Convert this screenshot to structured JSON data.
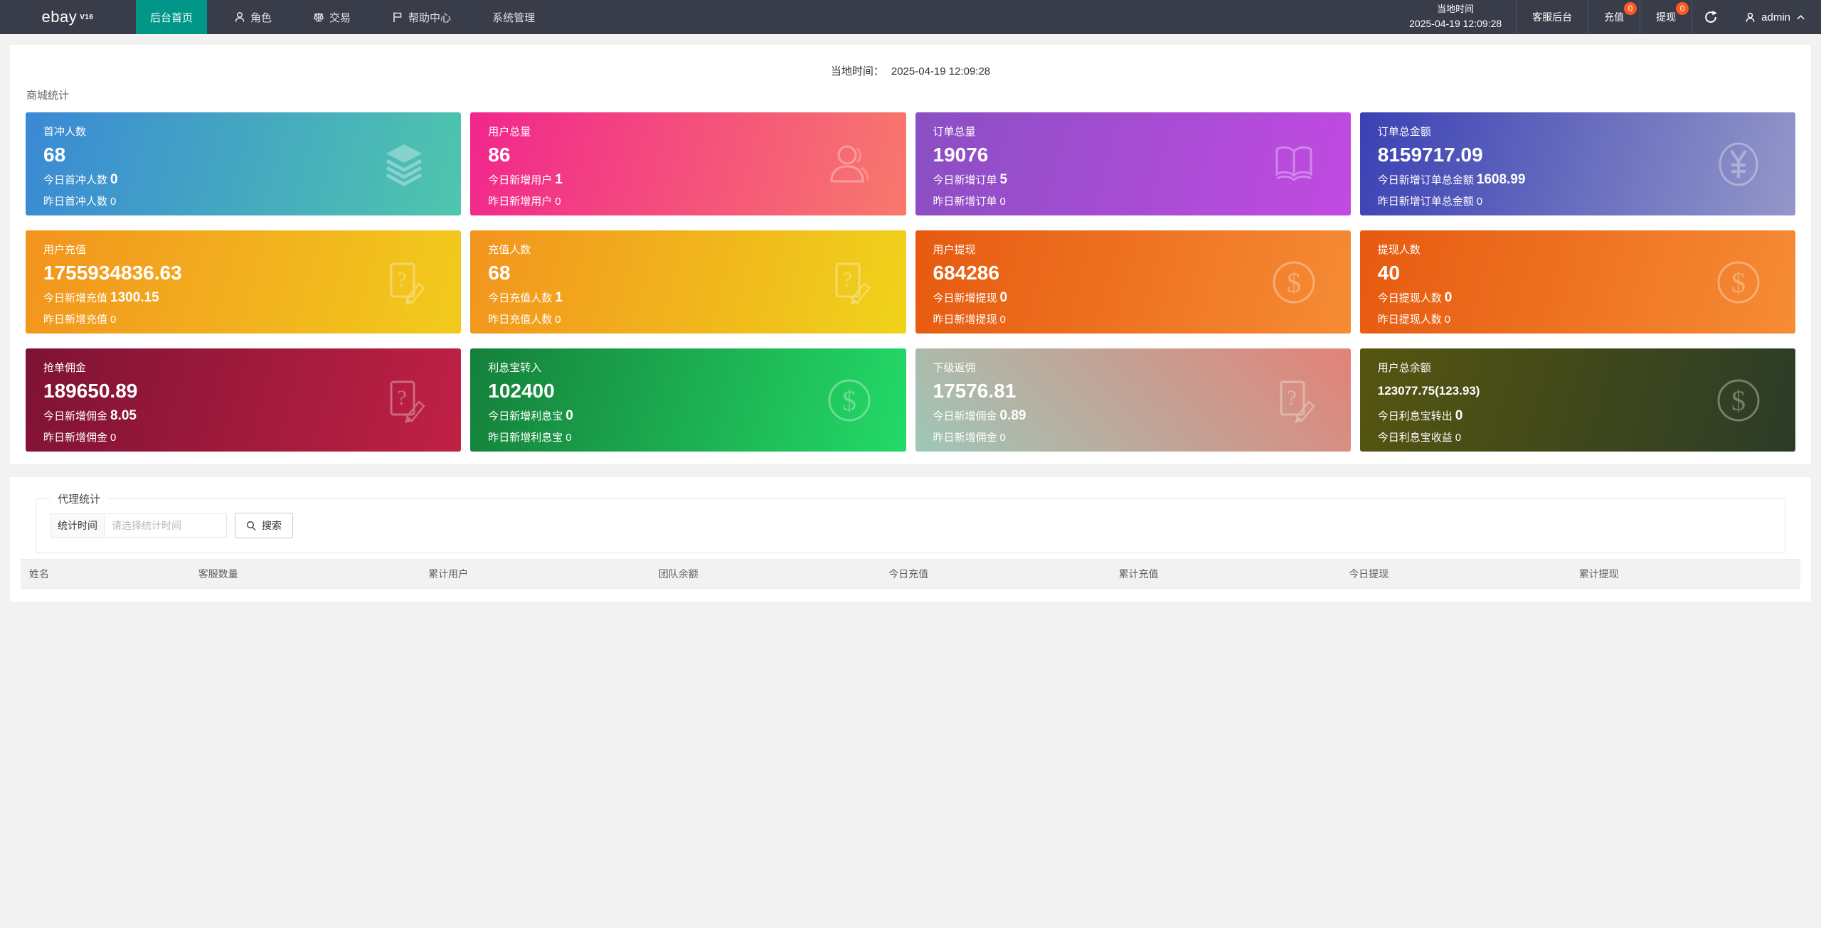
{
  "navbar": {
    "logo": "ebay",
    "logo_sup": "V16",
    "items": [
      {
        "label": "后台首页",
        "icon": null,
        "active": true
      },
      {
        "label": "角色",
        "icon": "user",
        "active": false
      },
      {
        "label": "交易",
        "icon": "scales",
        "active": false
      },
      {
        "label": "帮助中心",
        "icon": "flag",
        "active": false
      },
      {
        "label": "系统管理",
        "icon": null,
        "active": false
      }
    ],
    "time_block": {
      "label": "当地时间",
      "value": "2025-04-19 12:09:28"
    },
    "right_items": [
      {
        "label": "客服后台",
        "badge": null
      },
      {
        "label": "充值",
        "badge": "0"
      },
      {
        "label": "提现",
        "badge": "0"
      }
    ],
    "user": {
      "name": "admin"
    },
    "badge_color": "#ff5722",
    "active_color": "#009688",
    "bar_color": "#393d49"
  },
  "main": {
    "time_label": "当地时间：",
    "time_value": "2025-04-19 12:09:28",
    "section_title": "商城统计",
    "cards": [
      {
        "title": "首冲人数",
        "value": "68",
        "small": false,
        "line2_label": "今日首冲人数",
        "line2_value": "0",
        "line3_label": "昨日首冲人数",
        "line3_value": "0",
        "icon": "layers",
        "gradient": {
          "angle": 105,
          "from": "#3a89d5",
          "to": "#4fc6ad"
        }
      },
      {
        "title": "用户总量",
        "value": "86",
        "small": false,
        "line2_label": "今日新增用户",
        "line2_value": "1",
        "line3_label": "昨日新增用户",
        "line3_value": "0",
        "icon": "person",
        "gradient": {
          "angle": 105,
          "from": "#f1268d",
          "to": "#f8796c"
        }
      },
      {
        "title": "订单总量",
        "value": "19076",
        "small": false,
        "line2_label": "今日新增订单",
        "line2_value": "5",
        "line3_label": "昨日新增订单",
        "line3_value": "0",
        "icon": "book",
        "gradient": {
          "angle": 105,
          "from": "#8a4fc3",
          "to": "#c24ae2"
        }
      },
      {
        "title": "订单总金额",
        "value": "8159717.09",
        "small": false,
        "line2_label": "今日新增订单总金额",
        "line2_value": "1608.99",
        "line3_label": "昨日新增订单总金额",
        "line3_value": "0",
        "icon": "yuan",
        "gradient": {
          "angle": 105,
          "from": "#3b41b4",
          "to": "#9397c9"
        }
      },
      {
        "title": "用户充值",
        "value": "1755934836.63",
        "small": false,
        "line2_label": "今日新增充值",
        "line2_value": "1300.15",
        "line3_label": "昨日新增充值",
        "line3_value": "0",
        "icon": "docedit",
        "gradient": {
          "angle": 105,
          "from": "#f2941e",
          "to": "#f2cb1d"
        }
      },
      {
        "title": "充值人数",
        "value": "68",
        "small": false,
        "line2_label": "今日充值人数",
        "line2_value": "1",
        "line3_label": "昨日充值人数",
        "line3_value": "0",
        "icon": "docedit",
        "gradient": {
          "angle": 105,
          "from": "#f2941e",
          "to": "#f0d31b"
        }
      },
      {
        "title": "用户提现",
        "value": "684286",
        "small": false,
        "line2_label": "今日新增提现",
        "line2_value": "0",
        "line3_label": "昨日新增提现",
        "line3_value": "0",
        "icon": "dollar",
        "gradient": {
          "angle": 105,
          "from": "#e65a10",
          "to": "#f68c35"
        }
      },
      {
        "title": "提现人数",
        "value": "40",
        "small": false,
        "line2_label": "今日提现人数",
        "line2_value": "0",
        "line3_label": "昨日提现人数",
        "line3_value": "0",
        "icon": "dollar",
        "gradient": {
          "angle": 105,
          "from": "#e65a10",
          "to": "#f68c35"
        }
      },
      {
        "title": "抢单佣金",
        "value": "189650.89",
        "small": false,
        "line2_label": "今日新增佣金",
        "line2_value": "8.05",
        "line3_label": "昨日新增佣金",
        "line3_value": "0",
        "icon": "docedit",
        "gradient": {
          "angle": 105,
          "from": "#7e1233",
          "to": "#c02145"
        }
      },
      {
        "title": "利息宝转入",
        "value": "102400",
        "small": false,
        "line2_label": "今日新增利息宝",
        "line2_value": "0",
        "line3_label": "昨日新增利息宝",
        "line3_value": "0",
        "icon": "dollar",
        "gradient": {
          "angle": 105,
          "from": "#15803a",
          "to": "#23da68"
        }
      },
      {
        "title": "下级返佣",
        "value": "17576.81",
        "small": false,
        "line2_label": "今日新增佣金",
        "line2_value": "0.89",
        "line3_label": "昨日新增佣金",
        "line3_value": "0",
        "icon": "docedit",
        "gradient": {
          "angle": 45,
          "from": "#9fc7b7",
          "to": "#e28277"
        }
      },
      {
        "title": "用户总余额",
        "value": "123077.75(123.93)",
        "small": true,
        "line2_label": "今日利息宝转出",
        "line2_value": "0",
        "line3_label": "今日利息宝收益",
        "line3_value": "0",
        "icon": "dollar",
        "gradient": {
          "angle": 105,
          "from": "#56560f",
          "to": "#2b3b27"
        }
      }
    ]
  },
  "agent": {
    "legend": "代理统计",
    "filter_label": "统计时间",
    "filter_placeholder": "请选择统计时间",
    "search_label": "搜索",
    "table_headers": [
      "姓名",
      "客服数量",
      "累计用户",
      "团队余额",
      "今日充值",
      "累计充值",
      "今日提现",
      "累计提现"
    ]
  }
}
